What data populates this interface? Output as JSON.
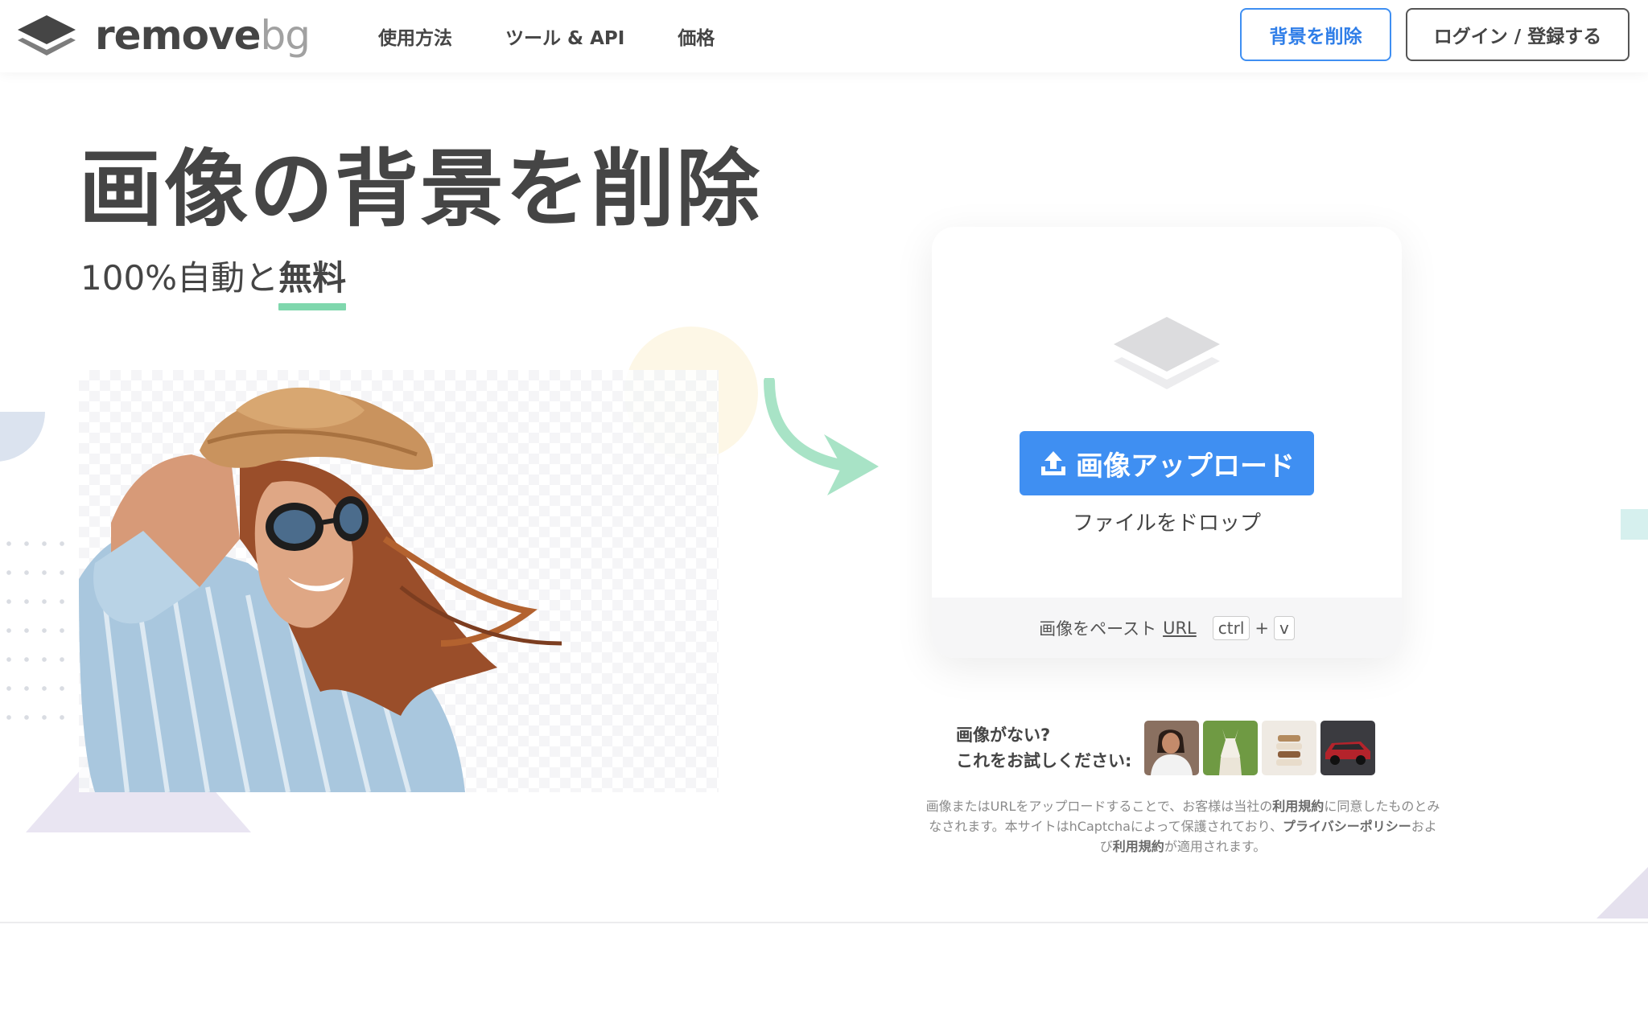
{
  "header": {
    "logo": {
      "main": "remove",
      "accent": "bg"
    },
    "nav": [
      "使用方法",
      "ツール & API",
      "価格"
    ],
    "remove_bg_button": "背景を削除",
    "login_button": "ログイン / 登録する"
  },
  "hero": {
    "title": "画像の背景を削除",
    "subtitle_prefix": "100%自動と",
    "subtitle_emphasis": "無料"
  },
  "upload": {
    "button": "画像アップロード",
    "drop": "ファイルをドロップ",
    "paste_text": "画像をペースト",
    "url_link": "URL",
    "key_ctrl": "ctrl",
    "key_plus": "+",
    "key_v": "v"
  },
  "samples": {
    "line1": "画像がない?",
    "line2": "これをお試しください:",
    "thumbnails": [
      "woman-sample",
      "llama-sample",
      "cake-sample",
      "car-sample"
    ]
  },
  "legal": {
    "p1": "画像またはURLをアップロードすることで、お客様は当社の",
    "terms1": "利用規約",
    "p2": "に同意したものとみなされます。本サイトはhCaptchaによって保護されており、",
    "privacy": "プライバシーポリシー",
    "p3": "および",
    "terms2": "利用規約",
    "p4": "が適用されます。"
  },
  "colors": {
    "accent_blue": "#3f8ff2",
    "underline_green": "#7fd7ad",
    "arrow_green": "#a8e3c6",
    "text_dark": "#454545"
  }
}
